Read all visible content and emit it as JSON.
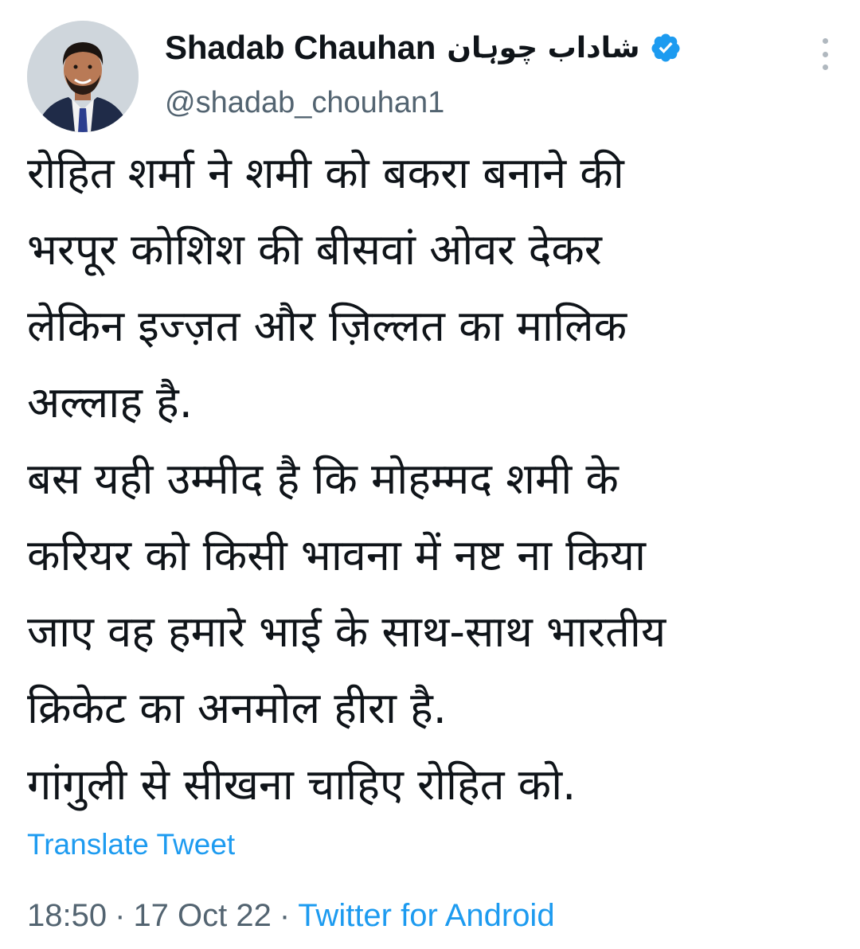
{
  "author": {
    "display_name": "Shadab Chauhan",
    "urdu_name": "شاداب چوہان",
    "handle": "@shadab_chouhan1",
    "verified": true,
    "avatar_icon": "profile-photo"
  },
  "tweet": {
    "lines": [
      "रोहित शर्मा ने शमी को बकरा बनाने की",
      "भरपूर कोशिश की बीसवां ओवर देकर",
      "लेकिन इज्ज़त और ज़िल्लत का मालिक",
      "अल्लाह है.",
      "बस यही उम्मीद है कि मोहम्मद शमी के",
      "करियर को किसी भावना में नष्ट ना किया",
      "जाए वह हमारे भाई के साथ-साथ भारतीय",
      "क्रिकेट का अनमोल हीरा है.",
      "गांगुली से सीखना चाहिए रोहित को."
    ],
    "translate_label": "Translate Tweet",
    "time": "18:50",
    "date": "17 Oct 22",
    "separator": "·",
    "source": "Twitter for Android"
  },
  "colors": {
    "text": "#0f1419",
    "secondary": "#536471",
    "link": "#1d9bf0",
    "verified": "#1d9bf0"
  },
  "icons": {
    "verified": "verified-badge-icon",
    "more": "more-vertical-icon"
  }
}
